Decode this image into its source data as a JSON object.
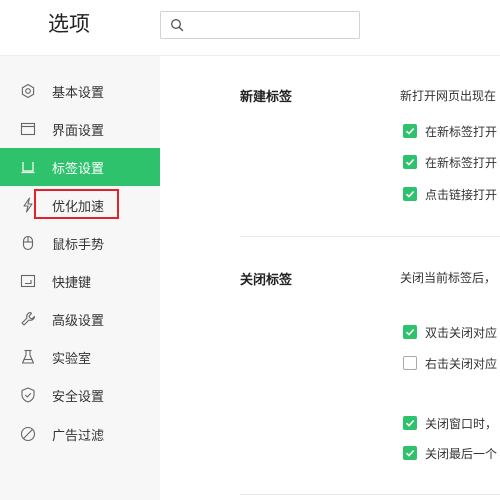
{
  "header": {
    "title": "选项",
    "search_placeholder": "",
    "search_value": ""
  },
  "sidebar": {
    "items": [
      {
        "label": "基本设置",
        "icon": "settings-icon"
      },
      {
        "label": "界面设置",
        "icon": "window-icon"
      },
      {
        "label": "标签设置",
        "icon": "tab-icon",
        "active": true
      },
      {
        "label": "优化加速",
        "icon": "lightning-icon"
      },
      {
        "label": "鼠标手势",
        "icon": "mouse-icon"
      },
      {
        "label": "快捷键",
        "icon": "keyboard-icon"
      },
      {
        "label": "高级设置",
        "icon": "wrench-icon"
      },
      {
        "label": "实验室",
        "icon": "flask-icon"
      },
      {
        "label": "安全设置",
        "icon": "shield-icon"
      },
      {
        "label": "广告过滤",
        "icon": "block-icon"
      }
    ]
  },
  "main": {
    "new_tab": {
      "title": "新建标签",
      "desc": "新打开网页出现在",
      "options": [
        {
          "label": "在新标签打开",
          "checked": true
        },
        {
          "label": "在新标签打开",
          "checked": true
        },
        {
          "label": "点击链接打开",
          "checked": true
        }
      ]
    },
    "close_tab": {
      "title": "关闭标签",
      "desc": "关闭当前标签后，",
      "options": [
        {
          "label": "双击关闭对应",
          "checked": true
        },
        {
          "label": "右击关闭对应",
          "checked": false
        },
        {
          "label": "关闭窗口时，",
          "checked": true
        },
        {
          "label": "关闭最后一个",
          "checked": true
        }
      ]
    }
  },
  "colors": {
    "accent": "#2dc26b",
    "highlight_box": "#e0242a"
  }
}
